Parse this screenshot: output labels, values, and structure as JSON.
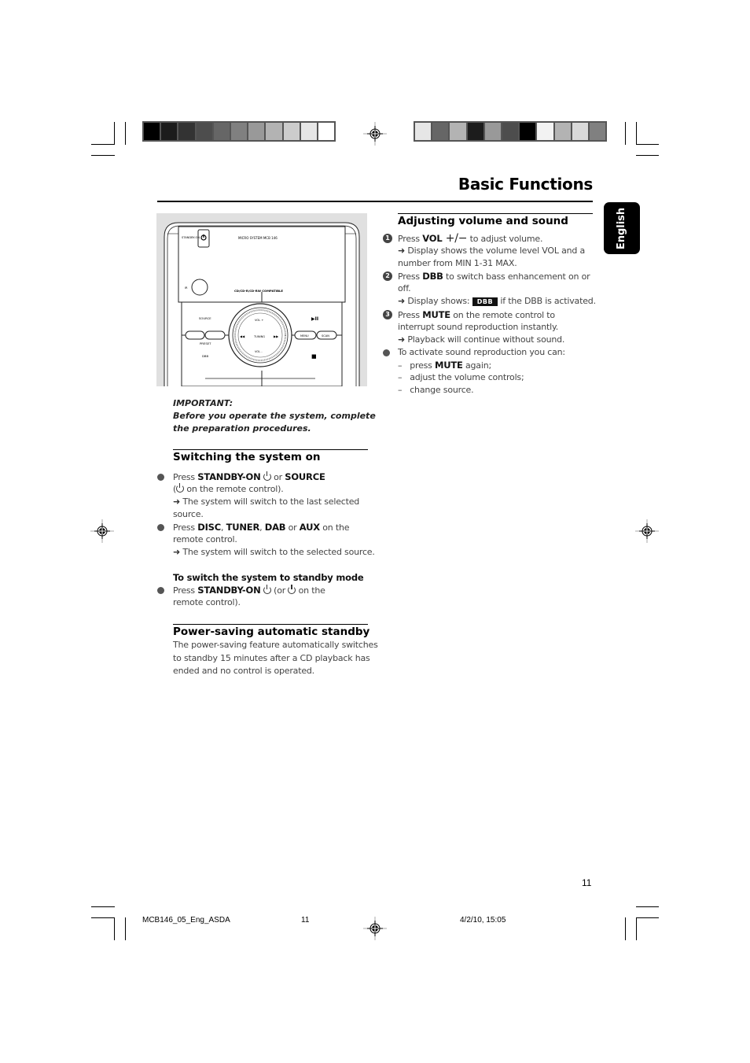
{
  "page": {
    "title": "Basic Functions",
    "language_tab": "English",
    "page_number": "11"
  },
  "colors": {
    "swatches_left": [
      "#000000",
      "#1c1c1c",
      "#333333",
      "#4d4d4d",
      "#666666",
      "#808080",
      "#999999",
      "#b3b3b3",
      "#cccccc",
      "#e6e6e6",
      "#ffffff"
    ],
    "swatches_right": [
      "#e6e6e6",
      "#666666",
      "#b3b3b3",
      "#1c1c1c",
      "#999999",
      "#4d4d4d",
      "#000000",
      "#f2f2f2",
      "#b3b3b3",
      "#d9d9d9",
      "#808080"
    ]
  },
  "device": {
    "standby_label": "STANDBY-ON",
    "model_label": "MICRO SYSTEM MCB 146",
    "ir_label": "IR",
    "compat_label": "CD/CD-R/CD-RW COMPATIBLE",
    "source_label": "SOURCE",
    "preset_label": "PRESET",
    "dbb_label": "DBB",
    "vol_plus": "VOL +",
    "vol_minus": "VOL -",
    "tuning": "TUNING",
    "menu": "MENU",
    "scan": "SCAN",
    "play_pause": "▶II",
    "stop": "■",
    "prev": "◀◀",
    "next": "▶▶"
  },
  "important": {
    "label": "IMPORTANT:",
    "line1": "Before you operate the system, complete",
    "line2": "the preparation procedures."
  },
  "switching_on": {
    "heading": "Switching the system on",
    "b1_press": "Press ",
    "b1_standby": "STANDBY-ON",
    "b1_or": " or ",
    "b1_source": "SOURCE",
    "b1_line2_open": "(",
    "b1_line2_rest": " on the remote control).",
    "b1_arrow1": "The system will switch to the last selected",
    "b1_arrow2": "source.",
    "b2_press": "Press ",
    "b2_disc": "DISC",
    "b2_comma1": ", ",
    "b2_tuner": "TUNER",
    "b2_comma2": ", ",
    "b2_dab": "DAB",
    "b2_or": " or ",
    "b2_aux": "AUX",
    "b2_rest": " on the",
    "b2_line2": "remote control.",
    "b2_arrow": "The system will switch to the selected source.",
    "standby_sub": "To switch the system to standby mode",
    "b3_press": "Press ",
    "b3_standby": "STANDBY-ON",
    "b3_mid": " (or ",
    "b3_rest": " on the",
    "b3_line2": "remote control)."
  },
  "power_saving": {
    "heading": "Power-saving automatic standby",
    "line1": "The power-saving feature automatically switches",
    "line2": "to standby 15 minutes after a CD playback has",
    "line3": "ended and no control is operated."
  },
  "volume": {
    "heading": "Adjusting volume and sound",
    "s1_num": "1",
    "s1_press": "Press ",
    "s1_vol": "VOL",
    "s1_pm": " +/−",
    "s1_rest": "   to adjust volume.",
    "s1_arrow1": "Display shows the volume level VOL and a",
    "s1_arrow2": "number from MIN 1-31 MAX.",
    "s2_num": "2",
    "s2_press": "Press ",
    "s2_dbb": "DBB",
    "s2_rest": " to switch bass enhancement on or",
    "s2_line2": "off.",
    "s2_arrow_pre": "Display shows: ",
    "s2_badge": "DBB",
    "s2_arrow_post": " if the DBB is activated.",
    "s3_num": "3",
    "s3_press": "Press ",
    "s3_mute": "MUTE",
    "s3_rest": " on the remote control to",
    "s3_line2": "interrupt sound reproduction instantly.",
    "s3_arrow": "Playback will continue without sound.",
    "b4": "To activate sound reproduction you can:",
    "d1_pre": "press ",
    "d1_mute": "MUTE",
    "d1_post": " again;",
    "d2": "adjust the volume controls;",
    "d3": "change source."
  },
  "footer": {
    "file": "MCB146_05_Eng_ASDA",
    "page": "11",
    "date": "4/2/10, 15:05"
  }
}
